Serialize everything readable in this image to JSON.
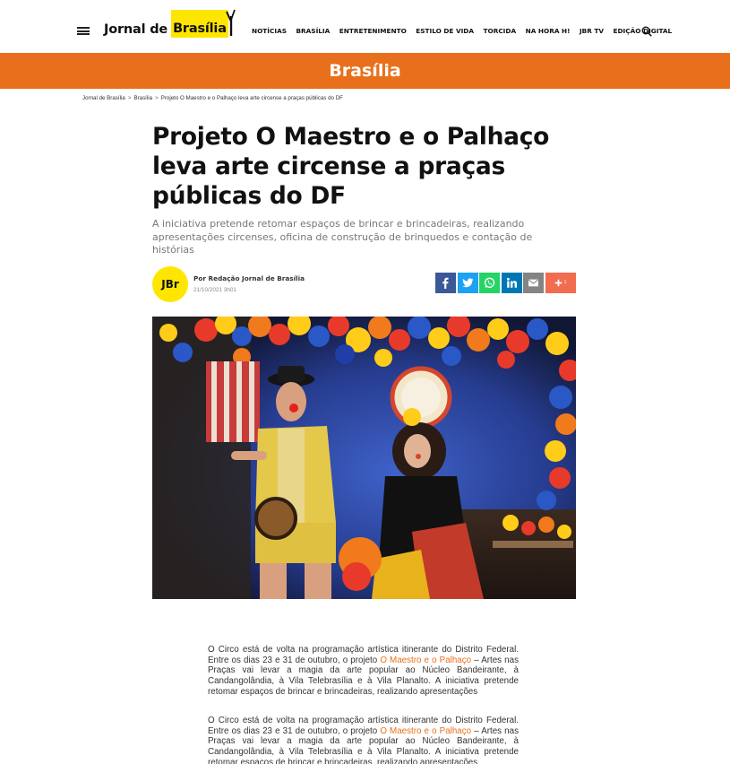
{
  "header": {
    "logo_text": "Jornal de",
    "logo_highlight": "Brasília",
    "nav": [
      "NOTÍCIAS",
      "BRASÍLIA",
      "ENTRETENIMENTO",
      "ESTILO DE VIDA",
      "TORCIDA",
      "NA HORA H!",
      "JBR TV",
      "EDIÇÃO DIGITAL"
    ]
  },
  "banner": {
    "title": "Brasília",
    "color": "#e8701c"
  },
  "breadcrumb": {
    "home": "Jornal de Brasília",
    "section": "Brasília",
    "current": "Projeto O Maestro e o Palhaço leva arte circense a praças públicas do DF",
    "separator": ">"
  },
  "article": {
    "title": "Projeto O Maestro e o Palhaço leva arte circense a praças públicas do DF",
    "subtitle": "A iniciativa pretende retomar espaços de brincar e brincadeiras, realizando apresentações circenses, oficina de construção de brinquedos e contação de histórias",
    "avatar_text": "JBr",
    "author": "Por Redação Jornal de Brasília",
    "date": "21/10/2021 3h01"
  },
  "share": [
    {
      "network": "facebook",
      "icon": "facebook-icon",
      "color": "#3b5998"
    },
    {
      "network": "twitter",
      "icon": "twitter-icon",
      "color": "#1da1f2"
    },
    {
      "network": "whatsapp",
      "icon": "whatsapp-icon",
      "color": "#25d366"
    },
    {
      "network": "linkedin",
      "icon": "linkedin-icon",
      "color": "#0077b5"
    },
    {
      "network": "email",
      "icon": "email-icon",
      "color": "#848484"
    },
    {
      "network": "more",
      "icon": "plus-icon",
      "label": "+",
      "color": "#f26c4f"
    }
  ],
  "body": {
    "p1_before": "O Circo está de volta na programação artística itinerante do Distrito Federal. Entre os dias 23 e 31 de outubro, o projeto ",
    "p1_link": "O Maestro e o Palhaço",
    "p1_after": " – Artes nas Praças vai levar a magia da arte popular ao Núcleo Bandeirante, à Candangolândia, à Vila Telebrasília e à Vila Planalto. A iniciativa pretende retomar espaços de brincar e brincadeiras, realizando apresentações",
    "p2_before": "O Circo está de volta na programação artística itinerante do Distrito Federal. Entre os dias 23 e 31 de outubro, o projeto ",
    "p2_link": "O Maestro e o Palhaço",
    "p2_after": " – Artes nas Praças vai levar a magia da arte popular ao Núcleo Bandeirante, à Candangolândia, à Vila Telebrasília e à Vila Planalto. A iniciativa pretende retomar espaços de brincar e brincadeiras, realizando apresentações"
  },
  "colors": {
    "accent": "#e8701c",
    "logo_yellow": "#ffe600"
  }
}
